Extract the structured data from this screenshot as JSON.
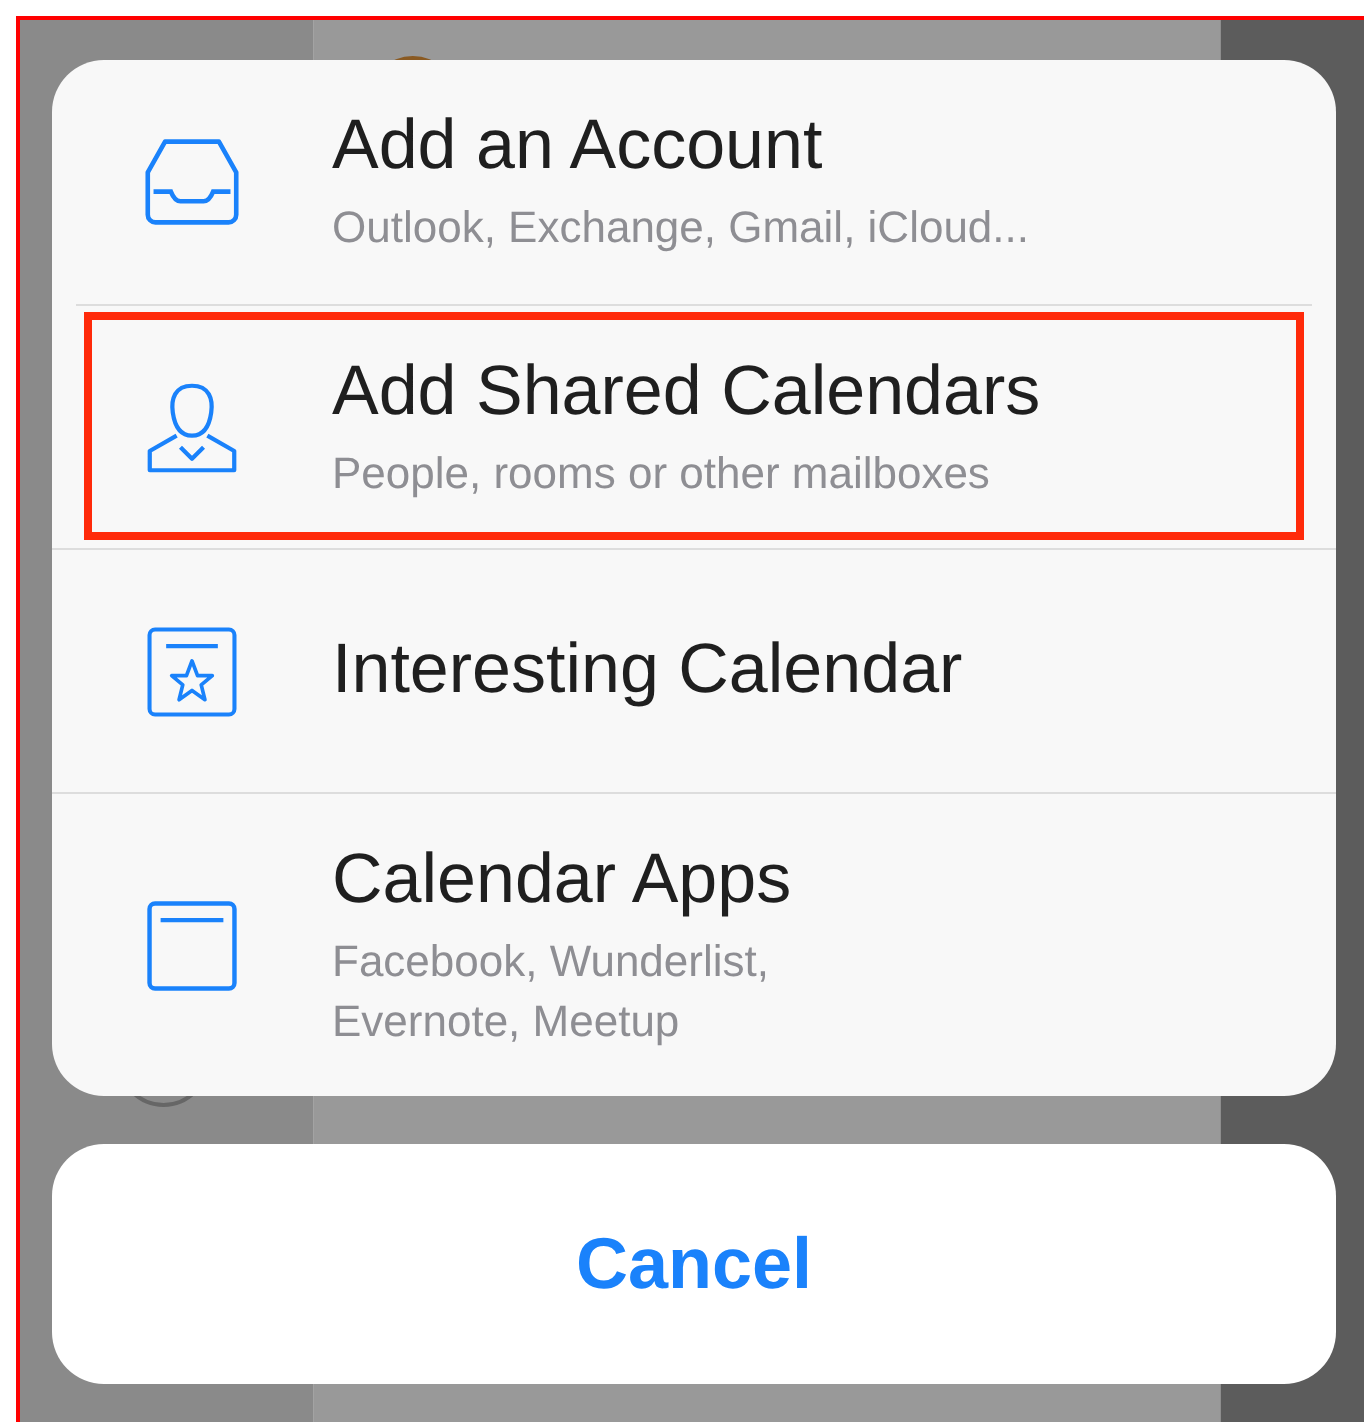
{
  "action_sheet": {
    "items": [
      {
        "kind": "inbox",
        "title": "Add an Account",
        "subtitle": "Outlook, Exchange, Gmail, iCloud...",
        "highlighted": false
      },
      {
        "kind": "person",
        "title": "Add Shared Calendars",
        "subtitle": "People, rooms or other mailboxes",
        "highlighted": true
      },
      {
        "kind": "star-calendar",
        "title": "Interesting Calendar",
        "highlighted": false
      },
      {
        "kind": "calendar",
        "title": "Calendar Apps",
        "subtitle": "Facebook, Wunderlist,\nEvernote, Meetup",
        "highlighted": false
      }
    ]
  },
  "cancel_button": {
    "label": "Cancel"
  }
}
